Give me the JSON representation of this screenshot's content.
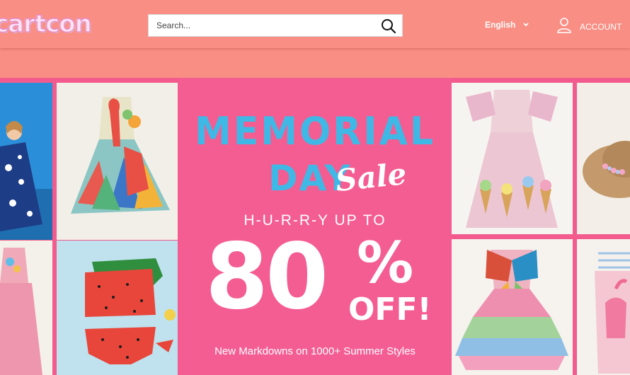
{
  "header": {
    "logo_text": "cartcon",
    "search": {
      "placeholder": "Search...",
      "icon": "search-icon"
    },
    "language": {
      "label": "English",
      "icon": "chevron-down-icon"
    },
    "account": {
      "label": "ACCOUNT",
      "icon": "user-icon"
    },
    "background_color": "#f98f84"
  },
  "banner": {
    "headline_1": "MEMORIAL",
    "headline_2": "DAY",
    "headline_script": "Sale",
    "hurry": "H-U-R-R-Y UP TO",
    "discount_value": "80",
    "discount_symbol": "%",
    "discount_suffix": "OFF!",
    "subline": "New Markdowns on 1000+ Summer Styles",
    "background_color": "#f45d92",
    "accent_color": "#3fb8e6",
    "product_tiles": [
      "girl-blue-floral-dress",
      "flamingo-feather-dress",
      "pink-dress-girl",
      "watermelon-swimsuit",
      "ice-cream-tulle-dress",
      "straw-sun-hat",
      "butterfly-ruffle-dress",
      "flamingo-ruffle-swimsuit"
    ]
  }
}
